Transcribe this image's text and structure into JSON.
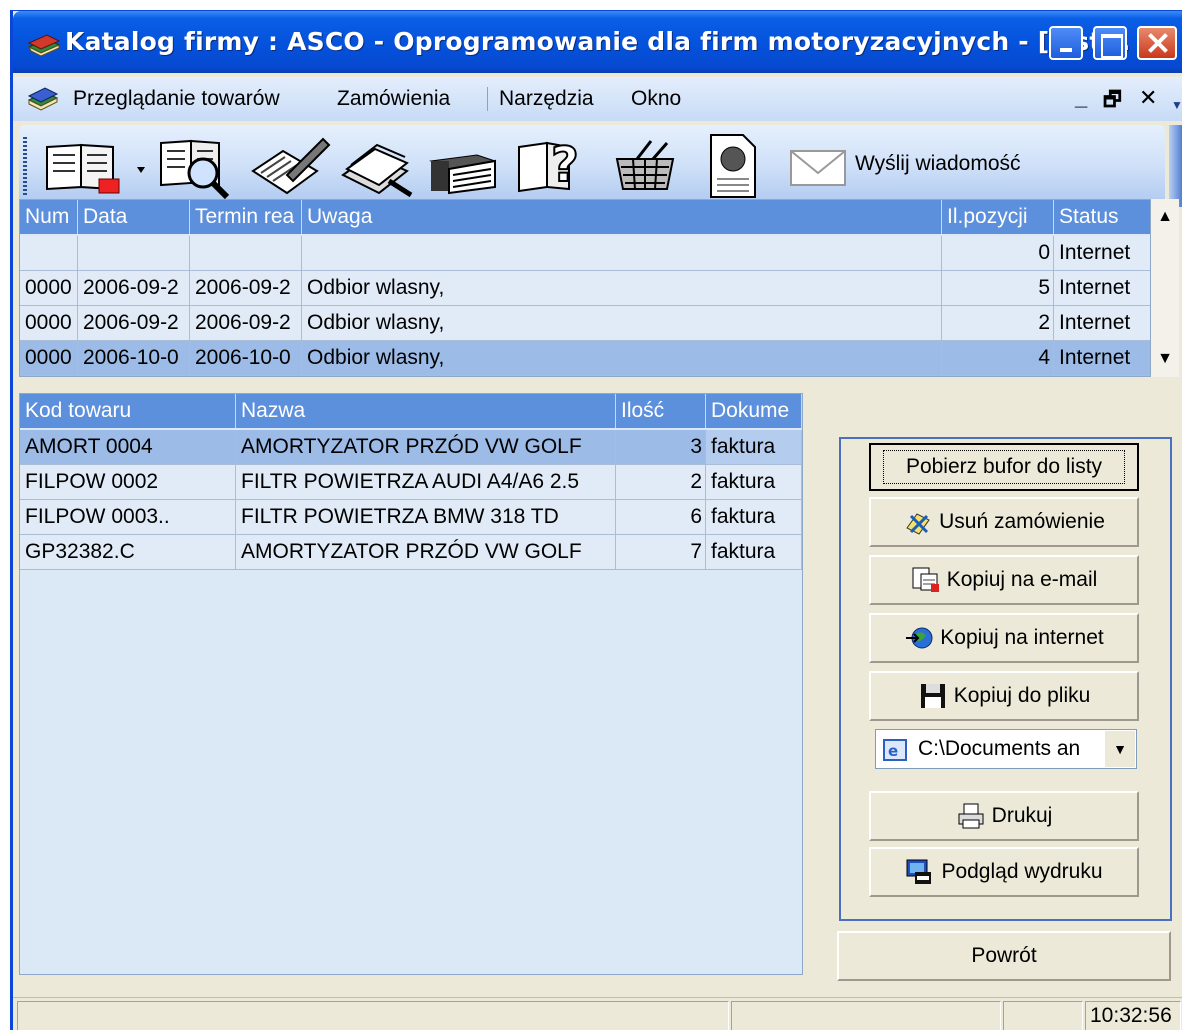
{
  "window": {
    "title": "Katalog firmy : ASCO - Oprogramowanie dla firm motoryzacyjnych - [List..."
  },
  "menu": {
    "items": [
      "Przeglądanie towarów",
      "Zamówienia",
      "Narzędzia",
      "Okno"
    ],
    "mdi_controls": [
      "_",
      "🗗",
      "✕"
    ]
  },
  "toolbar": {
    "icons": [
      "catalog-search-icon",
      "book-search-icon",
      "notes-edit-icon",
      "documents-icon",
      "books-stack-icon",
      "help-icon",
      "basket-icon",
      "document-globe-icon",
      "envelope-icon"
    ],
    "send_label": "Wyślij wiadomość"
  },
  "orders": {
    "columns": [
      "Num",
      "Data",
      "Termin rea",
      "Uwaga",
      "Il.pozycji",
      "Status"
    ],
    "rows": [
      [
        "",
        "",
        "",
        "",
        "0",
        "Internet"
      ],
      [
        "0000",
        "2006-09-2",
        "2006-09-2",
        "Odbior wlasny,",
        "5",
        "Internet"
      ],
      [
        "0000",
        "2006-09-2",
        "2006-09-2",
        "Odbior wlasny,",
        "2",
        "Internet"
      ],
      [
        "0000",
        "2006-10-0",
        "2006-10-0",
        "Odbior wlasny,",
        "4",
        "Internet"
      ]
    ],
    "selected_row": 3
  },
  "items": {
    "columns": [
      "Kod towaru",
      "Nazwa",
      "Ilość",
      "Dokume"
    ],
    "rows": [
      [
        "AMORT 0004",
        "AMORTYZATOR PRZÓD VW GOLF",
        "3",
        "faktura"
      ],
      [
        "FILPOW 0002",
        "FILTR POWIETRZA AUDI A4/A6 2.5",
        "2",
        "faktura"
      ],
      [
        "FILPOW 0003..",
        "FILTR POWIETRZA BMW 318 TD",
        "6",
        "faktura"
      ],
      [
        "GP32382.C",
        "AMORTYZATOR PRZÓD VW GOLF",
        "7",
        "faktura"
      ]
    ],
    "selected_row": 0
  },
  "actions": {
    "fetch": "Pobierz bufor do listy",
    "delete": "Usuń zamówienie",
    "copy_email": "Kopiuj na e-mail",
    "copy_internet": "Kopiuj na internet",
    "copy_file": "Kopiuj do pliku",
    "path": "C:\\Documents an",
    "print": "Drukuj",
    "preview": "Podgląd wydruku",
    "back": "Powrót"
  },
  "status": {
    "time": "10:32:56"
  }
}
